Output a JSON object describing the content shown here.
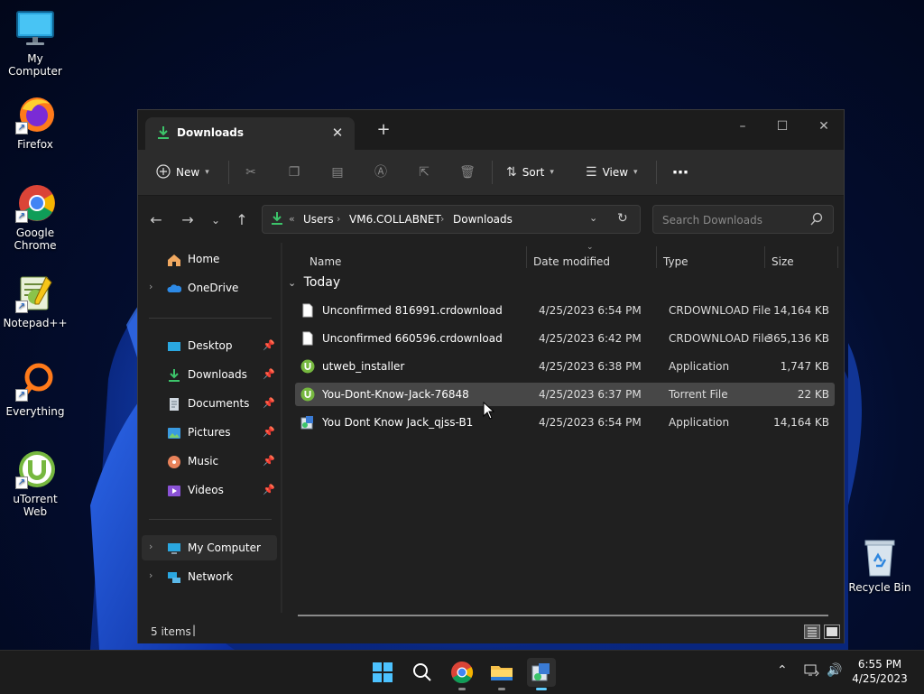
{
  "desktop": {
    "icons": [
      {
        "label": "My Computer",
        "icon": "monitor-icon"
      },
      {
        "label": "Firefox",
        "icon": "firefox-icon"
      },
      {
        "label": "Google Chrome",
        "icon": "chrome-icon"
      },
      {
        "label": "Notepad++",
        "icon": "notepad-plus-plus-icon"
      },
      {
        "label": "Everything",
        "icon": "everything-search-icon"
      },
      {
        "label": "uTorrent Web",
        "icon": "utorrent-icon"
      }
    ],
    "recycle_bin": {
      "label": "Recycle Bin",
      "icon": "recycle-bin-icon"
    }
  },
  "window": {
    "tab": {
      "label": "Downloads",
      "close": "✕"
    },
    "new_tab": "+",
    "controls": {
      "minimize": "–",
      "maximize": "☐",
      "close": "✕"
    },
    "toolbar": {
      "new_label": "New",
      "sort_label": "Sort",
      "view_label": "View",
      "more": "⋯"
    },
    "address": {
      "overflow": "«",
      "crumbs": [
        "Users",
        "VM6.COLLABNET",
        "Downloads"
      ],
      "separator": "›"
    },
    "search": {
      "placeholder": "Search Downloads"
    },
    "nav": {
      "home": "Home",
      "onedrive": "OneDrive",
      "desktop": "Desktop",
      "downloads": "Downloads",
      "documents": "Documents",
      "pictures": "Pictures",
      "music": "Music",
      "videos": "Videos",
      "my_computer": "My Computer",
      "network": "Network"
    },
    "columns": {
      "name": "Name",
      "date": "Date modified",
      "type": "Type",
      "size": "Size"
    },
    "group": "Today",
    "files": [
      {
        "name": "Unconfirmed 816991.crdownload",
        "date": "4/25/2023 6:54 PM",
        "type": "CRDOWNLOAD File",
        "size": "14,164 KB",
        "icon": "blank-file-icon"
      },
      {
        "name": "Unconfirmed 660596.crdownload",
        "date": "4/25/2023 6:42 PM",
        "type": "CRDOWNLOAD File",
        "size": "365,136 KB",
        "icon": "blank-file-icon"
      },
      {
        "name": "utweb_installer",
        "date": "4/25/2023 6:38 PM",
        "type": "Application",
        "size": "1,747 KB",
        "icon": "utorrent-app-icon"
      },
      {
        "name": "You-Dont-Know-Jack-76848",
        "date": "4/25/2023 6:37 PM",
        "type": "Torrent File",
        "size": "22 KB",
        "icon": "torrent-file-icon"
      },
      {
        "name": "You Dont Know Jack_qjss-B1",
        "date": "4/25/2023 6:54 PM",
        "type": "Application",
        "size": "14,164 KB",
        "icon": "installer-app-icon"
      }
    ],
    "status": {
      "items": "5 items"
    }
  },
  "taskbar": {
    "clock_time": "6:55 PM",
    "clock_date": "4/25/2023"
  },
  "colors": {
    "window_bg": "#202020",
    "toolbar_bg": "#2c2c2c",
    "selected_row": "#474747",
    "download_accent": "#3cc46a",
    "taskbar_active": "#60cdff"
  }
}
